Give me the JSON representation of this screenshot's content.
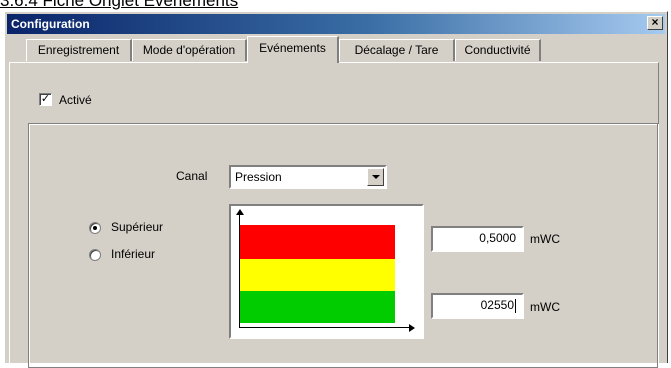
{
  "document": {
    "heading": "3.6.4 Fiche Onglet Evénements"
  },
  "window": {
    "title": "Configuration",
    "close_label": "×"
  },
  "tabs": [
    {
      "label": "Enregistrement",
      "active": false
    },
    {
      "label": "Mode d'opération",
      "active": false
    },
    {
      "label": "Evénements",
      "active": true
    },
    {
      "label": "Décalage / Tare",
      "active": false
    },
    {
      "label": "Conductivité",
      "active": false
    }
  ],
  "events": {
    "enabled_label": "Activé",
    "enabled_mark": "✓",
    "channel_label": "Canal",
    "channel_value": "Pression",
    "radios": [
      {
        "label": "Supérieur",
        "checked": true
      },
      {
        "label": "Inférieur",
        "checked": false
      }
    ],
    "upper_value": "0,5000",
    "upper_unit": "mWC",
    "lower_value": "02550",
    "lower_unit": "mWC"
  },
  "colors": {
    "high_band": "#ff0000",
    "mid_band": "#ffff00",
    "low_band": "#00cc00",
    "title_bar": "#0a246a",
    "face": "#d4d0c8"
  }
}
